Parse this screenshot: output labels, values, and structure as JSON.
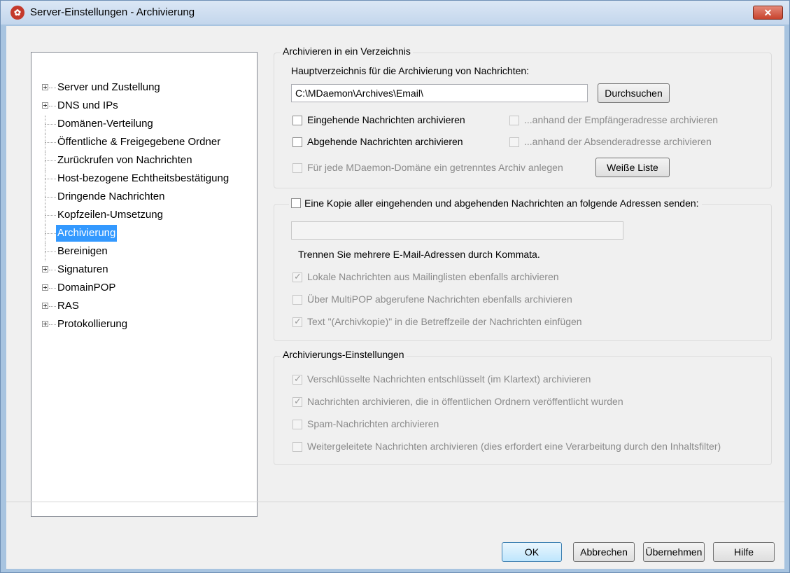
{
  "window": {
    "title": "Server-Einstellungen - Archivierung",
    "close": "✕"
  },
  "tree": {
    "items": [
      {
        "label": "Server und Zustellung",
        "expandable": true
      },
      {
        "label": "DNS und IPs",
        "expandable": true
      },
      {
        "label": "Domänen-Verteilung",
        "expandable": false
      },
      {
        "label": "Öffentliche & Freigegebene Ordner",
        "expandable": false
      },
      {
        "label": "Zurückrufen von Nachrichten",
        "expandable": false
      },
      {
        "label": "Host-bezogene Echtheitsbestätigung",
        "expandable": false
      },
      {
        "label": "Dringende Nachrichten",
        "expandable": false
      },
      {
        "label": "Kopfzeilen-Umsetzung",
        "expandable": false
      },
      {
        "label": "Archivierung",
        "expandable": false,
        "selected": true
      },
      {
        "label": "Bereinigen",
        "expandable": false
      },
      {
        "label": "Signaturen",
        "expandable": true
      },
      {
        "label": "DomainPOP",
        "expandable": true
      },
      {
        "label": "RAS",
        "expandable": true
      },
      {
        "label": "Protokollierung",
        "expandable": true
      }
    ]
  },
  "archive_dir": {
    "group_title": "Archivieren in ein Verzeichnis",
    "path_label": "Hauptverzeichnis für die Archivierung von Nachrichten:",
    "path_value": "C:\\MDaemon\\Archives\\Email\\",
    "browse": "Durchsuchen",
    "incoming": "Eingehende Nachrichten archivieren",
    "by_recipient": "...anhand der Empfängeradresse archivieren",
    "outgoing": "Abgehende Nachrichten archivieren",
    "by_sender": "...anhand der Absenderadresse archivieren",
    "per_domain": "Für jede MDaemon-Domäne ein getrenntes Archiv anlegen",
    "whitelist": "Weiße Liste"
  },
  "copy": {
    "group_title": "Eine Kopie aller eingehenden und abgehenden Nachrichten an folgende Adressen senden:",
    "address_value": "",
    "hint": "Trennen Sie mehrere E-Mail-Adressen durch Kommata.",
    "local_lists": "Lokale Nachrichten aus Mailinglisten ebenfalls archivieren",
    "multipop": "Über MultiPOP abgerufene Nachrichten ebenfalls archivieren",
    "subject_text": "Text \"(Archivkopie)\" in die Betreffzeile der Nachrichten einfügen"
  },
  "settings": {
    "group_title": "Archivierungs-Einstellungen",
    "decrypted": "Verschlüsselte Nachrichten entschlüsselt (im Klartext) archivieren",
    "public_folders": "Nachrichten archivieren, die in öffentlichen Ordnern veröffentlicht wurden",
    "spam": "Spam-Nachrichten archivieren",
    "forwarded": "Weitergeleitete Nachrichten archivieren (dies erfordert eine Verarbeitung durch den Inhaltsfilter)"
  },
  "buttons": {
    "ok": "OK",
    "cancel": "Abbrechen",
    "apply": "Übernehmen",
    "help": "Hilfe"
  },
  "colors": {
    "selection": "#3399ff",
    "dialog": "#f0f0f0",
    "disabled_text": "#8a8a8a"
  }
}
